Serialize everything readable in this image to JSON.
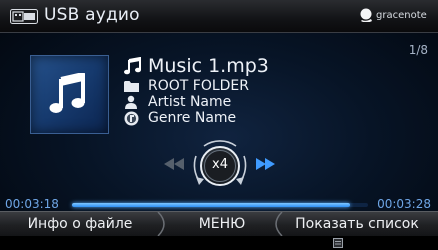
{
  "header": {
    "source_icon": "usb-icon",
    "title": "USB аудио",
    "brand_icon": "gracenote-logo-icon",
    "brand": "gracenote"
  },
  "track": {
    "counter": "1/8",
    "title": "Music 1.mp3",
    "title_icon": "music-note-icon",
    "folder": "ROOT FOLDER",
    "folder_icon": "folder-icon",
    "artist": "Artist Name",
    "artist_icon": "person-icon",
    "genre": "Genre Name",
    "genre_icon": "genre-disc-icon",
    "album_art_icon": "music-note-icon"
  },
  "playback": {
    "speed_label": "x4",
    "rewind_icon": "rewind-icon",
    "fast_forward_icon": "fast-forward-icon",
    "elapsed": "00:03:18",
    "total": "00:03:28",
    "progress": 0.94
  },
  "softkeys": {
    "left": "Инфо о файле",
    "middle": "МЕНЮ",
    "right": "Показать список"
  },
  "footer": {
    "status_icon": "small-status-icon"
  },
  "colors": {
    "accent": "#3d9bff",
    "time_text": "#6fa6e6",
    "background": "#071426"
  }
}
